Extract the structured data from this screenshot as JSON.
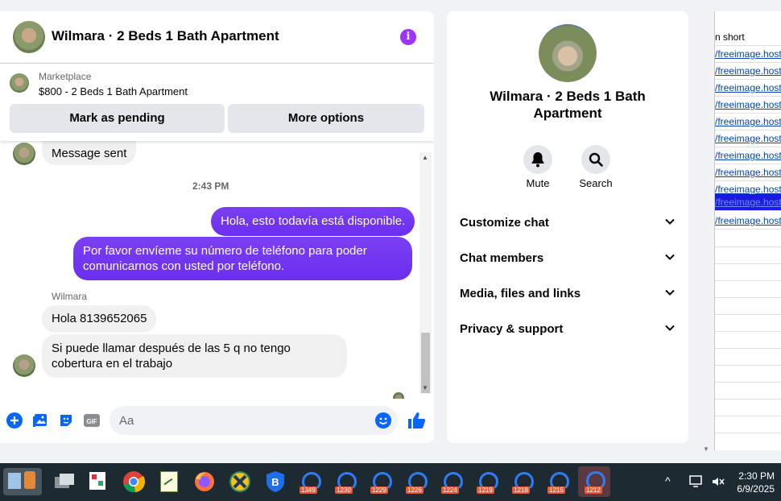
{
  "header": {
    "title": "Wilmara · 2 Beds 1 Bath Apartment",
    "info_icon": "info-icon"
  },
  "marketplace": {
    "label": "Marketplace",
    "item": "$800 - 2 Beds 1 Bath Apartment",
    "pending_button": "Mark as pending",
    "more_button": "More options"
  },
  "messages": {
    "partial_top": "Message sent",
    "time": "2:43 PM",
    "out1": "Hola, esto todavía está disponible.",
    "out2_line1": "Por favor envíeme su número de teléfono para poder",
    "out2_line2": "comunicarnos con usted por teléfono.",
    "sender": "Wilmara",
    "in1": "Hola 8139652065",
    "in2_line1": "Si puede llamar después de las 5 q no tengo",
    "in2_line2": "cobertura en el trabajo"
  },
  "composer": {
    "placeholder": "Aa"
  },
  "profile": {
    "title_line1": "Wilmara · 2 Beds 1 Bath",
    "title_line2": "Apartment",
    "mute_label": "Mute",
    "search_label": "Search",
    "sections": [
      "Customize chat",
      "Chat members",
      "Media, files and links",
      "Privacy & support"
    ]
  },
  "background_sheet": {
    "header": "n short",
    "links": [
      "/freeimage.host",
      "/freeimage.host",
      "/freeimage.host",
      "/freeimage.host",
      "/freeimage.host",
      "/freeimage.host",
      "/freeimage.host",
      "/freeimage.host",
      "/freeimage.host",
      "/freeimage.host",
      "/freeimage.host"
    ]
  },
  "taskbar": {
    "badges": [
      "1349",
      "1230",
      "1229",
      "1226",
      "1224",
      "1219",
      "1218",
      "1215",
      "1212"
    ],
    "time": "2:30 PM",
    "date": "6/9/2025"
  },
  "colors": {
    "accent": "#0866ff",
    "outgoing": "#7b3ff2",
    "info": "#a033ff"
  }
}
